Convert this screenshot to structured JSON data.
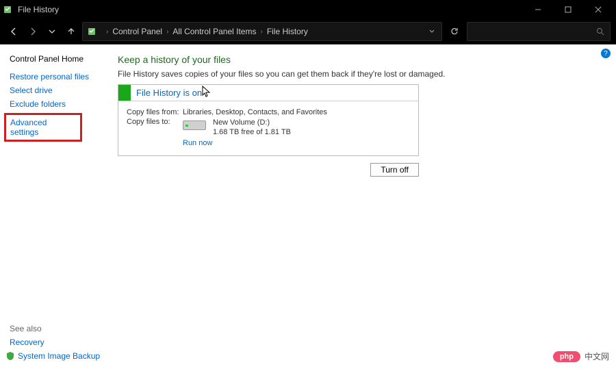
{
  "titlebar": {
    "title": "File History"
  },
  "breadcrumbs": [
    "Control Panel",
    "All Control Panel Items",
    "File History"
  ],
  "sidebar": {
    "home": "Control Panel Home",
    "links": [
      "Restore personal files",
      "Select drive",
      "Exclude folders"
    ],
    "highlighted": "Advanced settings",
    "seealso_heading": "See also",
    "seealso": [
      "Recovery",
      "System Image Backup"
    ]
  },
  "main": {
    "heading": "Keep a history of your files",
    "subtext": "File History saves copies of your files so you can get them back if they're lost or damaged.",
    "status": "File History is on",
    "copy_from_label": "Copy files from:",
    "copy_from_value": "Libraries, Desktop, Contacts, and Favorites",
    "copy_to_label": "Copy files to:",
    "drive_name": "New Volume (D:)",
    "drive_space": "1.68 TB free of 1.81 TB",
    "run_now": "Run now",
    "turn_off": "Turn off"
  },
  "watermark": {
    "pill": "php",
    "text": "中文网"
  }
}
